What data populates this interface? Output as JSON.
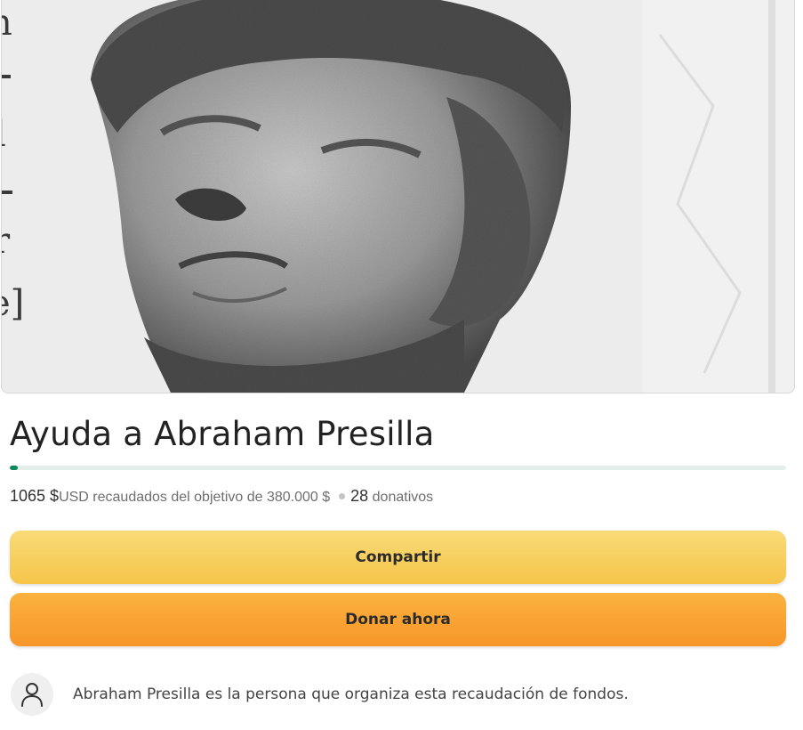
{
  "hero": {
    "alt": "Ayuda a Abraham Presilla"
  },
  "campaign": {
    "title": "Ayuda a Abraham Presilla",
    "raised": "1065 $",
    "currency": "USD",
    "goal_text": "recaudados del objetivo de 380.000 $",
    "donations_count": "28",
    "donations_label": "donativos",
    "progress_fraction": 0.0028
  },
  "buttons": {
    "share_label": "Compartir",
    "donate_label": "Donar ahora"
  },
  "organizer": {
    "text": "Abraham Presilla es la persona que organiza esta recaudación de fondos."
  },
  "icons": {
    "avatar": "user-icon"
  },
  "colors": {
    "progress": "#0a8a5a",
    "share_button": "#f6c549",
    "donate_button": "#f8962a"
  }
}
